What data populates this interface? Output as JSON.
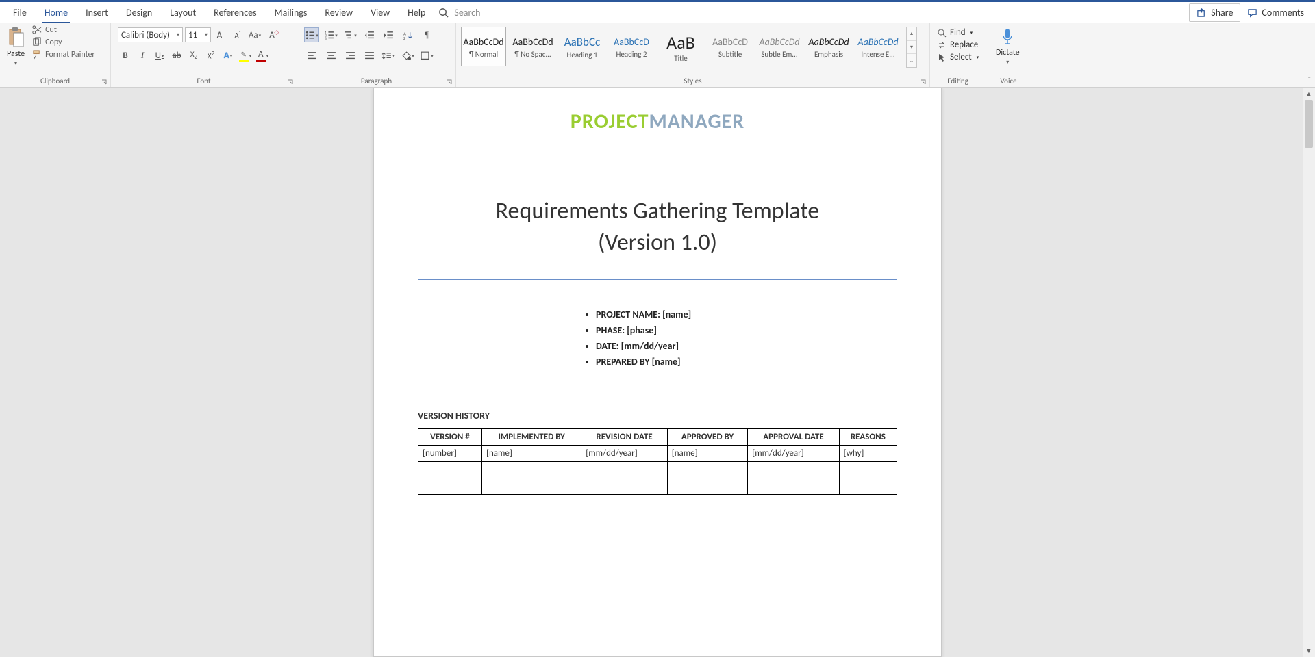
{
  "tabs": {
    "items": [
      "File",
      "Home",
      "Insert",
      "Design",
      "Layout",
      "References",
      "Mailings",
      "Review",
      "View",
      "Help"
    ],
    "active": 1,
    "search_placeholder": "Search",
    "share": "Share",
    "comments": "Comments"
  },
  "ribbon": {
    "clipboard": {
      "label": "Clipboard",
      "paste": "Paste",
      "cut": "Cut",
      "copy": "Copy",
      "format_painter": "Format Painter"
    },
    "font": {
      "label": "Font",
      "name": "Calibri (Body)",
      "size": "11"
    },
    "paragraph": {
      "label": "Paragraph"
    },
    "styles": {
      "label": "Styles",
      "items": [
        {
          "prev": "AaBbCcDd",
          "name": "¶ Normal",
          "cls": ""
        },
        {
          "prev": "AaBbCcDd",
          "name": "¶ No Spac...",
          "cls": ""
        },
        {
          "prev": "AaBbCc",
          "name": "Heading 1",
          "cls": "blue"
        },
        {
          "prev": "AaBbCcD",
          "name": "Heading 2",
          "cls": "blue"
        },
        {
          "prev": "AaB",
          "name": "Title",
          "cls": "big"
        },
        {
          "prev": "AaBbCcD",
          "name": "Subtitle",
          "cls": ""
        },
        {
          "prev": "AaBbCcDd",
          "name": "Subtle Em...",
          "cls": "ital"
        },
        {
          "prev": "AaBbCcDd",
          "name": "Emphasis",
          "cls": "ital"
        },
        {
          "prev": "AaBbCcDd",
          "name": "Intense E...",
          "cls": "blue ital"
        }
      ]
    },
    "editing": {
      "label": "Editing",
      "find": "Find",
      "replace": "Replace",
      "select": "Select"
    },
    "voice": {
      "label": "Voice",
      "dictate": "Dictate"
    }
  },
  "doc": {
    "logo": {
      "a": "PROJECT",
      "b": "MANAGER"
    },
    "title_line1": "Requirements Gathering Template",
    "title_line2": "(Version 1.0)",
    "bullets": [
      "PROJECT NAME: [name]",
      "PHASE: [phase]",
      "DATE: [mm/dd/year]",
      "PREPARED BY [name]"
    ],
    "section": "VERSION HISTORY",
    "table": {
      "headers": [
        "VERSION #",
        "IMPLEMENTED BY",
        "REVISION DATE",
        "APPROVED BY",
        "APPROVAL DATE",
        "REASONS"
      ],
      "rows": [
        [
          "[number]",
          "[name]",
          "[mm/dd/year]",
          "[name]",
          "[mm/dd/year]",
          "[why]"
        ],
        [
          "",
          "",
          "",
          "",
          "",
          ""
        ],
        [
          "",
          "",
          "",
          "",
          "",
          ""
        ]
      ]
    }
  }
}
